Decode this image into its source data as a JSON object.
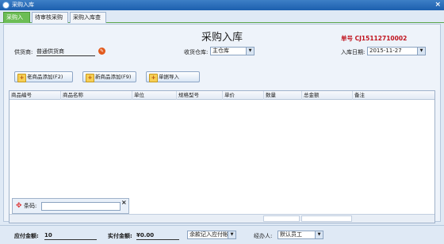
{
  "window": {
    "title": "采购入库",
    "close_glyph": "×"
  },
  "tabs": [
    {
      "label": "采购入库"
    },
    {
      "label": "待审核采购单"
    },
    {
      "label": "采购入库查询"
    }
  ],
  "form": {
    "title": "采购入库",
    "order_no": "单号  CJ15112710002",
    "supplier": {
      "label": "供货商:",
      "value": "普通供货商"
    },
    "warehouse": {
      "label": "收货仓库:",
      "value": "主仓库"
    },
    "date": {
      "label": "入库日期:",
      "value": "2015-11-27"
    }
  },
  "buttons": {
    "old_item": "老商品添加(F2)",
    "new_item": "新商品添加(F9)",
    "import": "单据导入"
  },
  "grid": {
    "columns": [
      "商品编号",
      "商品名称",
      "单位",
      "规格型号",
      "单价",
      "数量",
      "总金额",
      "备注"
    ]
  },
  "barcode": {
    "label": "条码:",
    "value": ""
  },
  "footer": {
    "payable_label": "应付金额:",
    "payable_value": "10",
    "paid_label": "实付金额:",
    "paid_value": "¥0.00",
    "balance_mode": "余款记入应付帐",
    "handler_label": "经办人:",
    "handler_value": "默认员工"
  },
  "icons": {
    "app": "app-icon",
    "supplier_picker": "wrench-icon",
    "add": "plus-icon",
    "barcode": "crosshair-icon",
    "dropdown": "chevron-down-icon"
  }
}
